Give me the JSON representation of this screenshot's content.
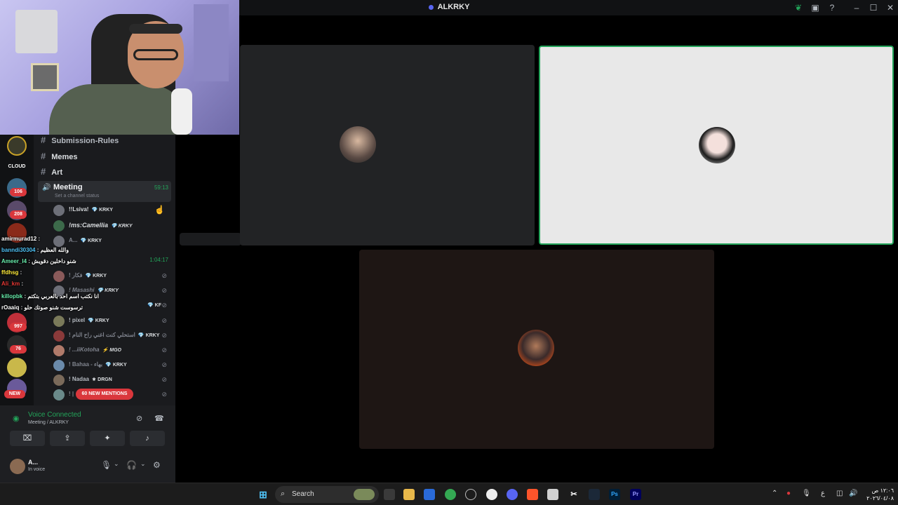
{
  "window": {
    "title": "ALKRKY"
  },
  "channels": [
    {
      "label": "Submission-Rules"
    },
    {
      "label": "Memes"
    },
    {
      "label": "Art"
    }
  ],
  "meeting": {
    "label": "Meeting",
    "timer": "59:13",
    "status": "Set a channel status"
  },
  "voice_users": [
    {
      "name": "!!Lsiva!",
      "tag": "KRKY"
    },
    {
      "name": "!ms:Camellia",
      "tag": "KRKY"
    },
    {
      "name": "A...",
      "tag": "KRKY"
    },
    {
      "name": "",
      "tag": "",
      "timer": "1:04:17"
    },
    {
      "name": "! فكار",
      "tag": "KRKY"
    },
    {
      "name": "! Masashi",
      "tag": "KRKY"
    },
    {
      "name": "",
      "tag": "KF"
    },
    {
      "name": "! pixel",
      "tag": "KRKY"
    },
    {
      "name": "! استحلي كنت اغني راح النام",
      "tag": "KRKY"
    },
    {
      "name": "! ...iiKotoha",
      "tag": "MGO"
    },
    {
      "name": "! Bahaa - بهاء",
      "tag": "KRKY"
    },
    {
      "name": "! Nadaa",
      "tag": "DRGN"
    },
    {
      "name": "! |",
      "tag": ""
    }
  ],
  "mentions": "60 NEW MENTIONS",
  "server_badges": [
    "106",
    "208",
    "997",
    "76",
    "NEW"
  ],
  "server_labels": [
    "CLOUD"
  ],
  "chat": [
    {
      "user": "amirmurad12",
      "msg": "",
      "color": "#ffffff"
    },
    {
      "user": "banndi30304",
      "msg": "والله العظيم",
      "color": "#4fc3f7"
    },
    {
      "user": "Ameer_l4",
      "msg": "شنو داخلين دقويش",
      "color": "#69f0ae"
    },
    {
      "user": "ffdhsg",
      "msg": "",
      "color": "#ffeb3b"
    },
    {
      "user": "Ali_km",
      "msg": "",
      "color": "#e53935"
    },
    {
      "user": "killopbk",
      "msg": "انا نكتب اسم احد بالعربي بتكتم",
      "color": "#69f0ae"
    },
    {
      "user": "rOaaiq",
      "msg": "ترسوست شنو صوتك حلو",
      "color": "#ffffff"
    }
  ],
  "voice_panel": {
    "title": "Voice Connected",
    "sub": "Meeting / ALKRKY",
    "me_name": "A...",
    "me_status": "In voice"
  },
  "taskbar": {
    "search_label": "Search",
    "lang": "ع",
    "time": "١٢:٠٦ ص",
    "date": "٢٠٢٦/٠٤/٠٨"
  },
  "colors": {
    "accent": "#5865f2",
    "online": "#23a55a",
    "danger": "#da373c",
    "speaking_border": "#23a55a"
  }
}
